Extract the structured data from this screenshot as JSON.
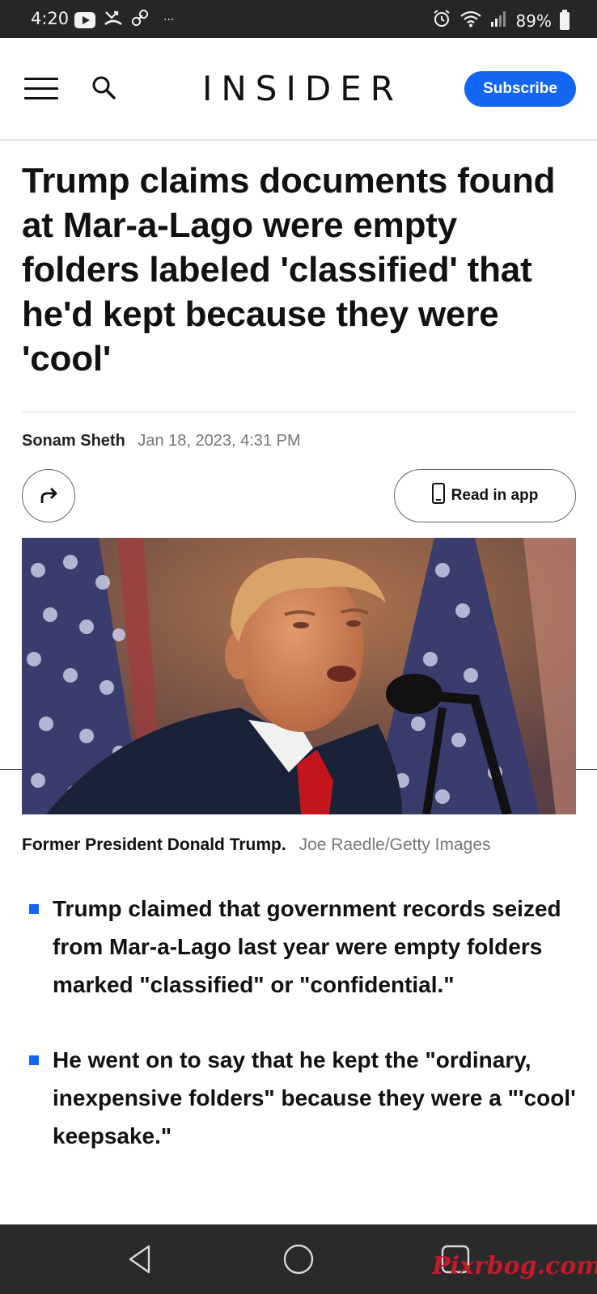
{
  "status_bar": {
    "time": "4:20",
    "more": "···",
    "battery": "89%"
  },
  "header": {
    "logo": "INSIDER",
    "subscribe_label": "Subscribe"
  },
  "article": {
    "headline": "Trump claims documents found at Mar-a-Lago were empty folders labeled 'classified' that he'd kept because they were 'cool'",
    "author": "Sonam Sheth",
    "date": "Jan 18, 2023, 4:31 PM",
    "read_in_app_label": "Read in app",
    "caption": "Former President Donald Trump.",
    "photo_credit": "Joe Raedle/Getty Images",
    "bullets": [
      "Trump claimed that government records seized from Mar-a-Lago last year were empty folders marked \"classified\" or \"confidential.\"",
      "He went on to say that he kept the \"ordinary, inexpensive folders\" because they were a \"'cool' keepsake.\""
    ]
  },
  "watermark": "Pixrbog.com",
  "colors": {
    "accent": "#1266f1",
    "status_bar_bg": "#262626",
    "nav_bar_bg": "#2a2a2a"
  }
}
